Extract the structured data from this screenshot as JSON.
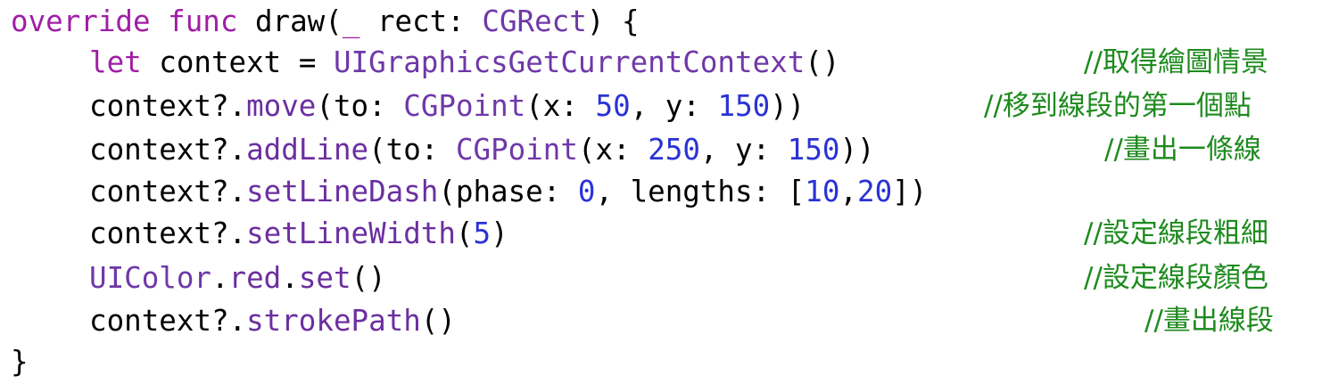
{
  "colors": {
    "keyword": "#a01ea6",
    "type": "#6f38a8",
    "method": "#6b2fa0",
    "number": "#2a32d6",
    "comment": "#1d8a1d",
    "plain": "#000000"
  },
  "code": {
    "l1": {
      "kw_override": "override",
      "kw_func": "func",
      "name": "draw(",
      "underscore": "_",
      "param": "rect:",
      "type": "CGRect",
      "tail": ") {"
    },
    "l2": {
      "kw_let": "let",
      "var": "context =",
      "fn": "UIGraphicsGetCurrentContext",
      "tail": "()",
      "comment": "//取得繪圖情景"
    },
    "l3": {
      "obj": "context?.",
      "method": "move",
      "open": "(to:",
      "type": "CGPoint",
      "x_label": "(x:",
      "x": "50",
      "y_label": ", y:",
      "y": "150",
      "close": "))",
      "comment": "//移到線段的第一個點"
    },
    "l4": {
      "obj": "context?.",
      "method": "addLine",
      "open": "(to:",
      "type": "CGPoint",
      "x_label": "(x:",
      "x": "250",
      "y_label": ", y:",
      "y": "150",
      "close": "))",
      "comment": "//畫出一條線"
    },
    "l5": {
      "obj": "context?.",
      "method": "setLineDash",
      "phase_label": "(phase:",
      "phase": "0",
      "lengths_label": ", lengths: [",
      "len1": "10",
      "comma": ",",
      "len2": "20",
      "close": "])"
    },
    "l6": {
      "obj": "context?.",
      "method": "setLineWidth",
      "open": "(",
      "width": "5",
      "close": ")",
      "comment": "//設定線段粗細"
    },
    "l7": {
      "type": "UIColor",
      "dot1": ".",
      "prop": "red",
      "dot2": ".",
      "method": "set",
      "tail": "()",
      "comment": "//設定線段顏色"
    },
    "l8": {
      "obj": "context?.",
      "method": "strokePath",
      "tail": "()",
      "comment": "//畫出線段"
    },
    "l9": {
      "brace": "}"
    }
  }
}
